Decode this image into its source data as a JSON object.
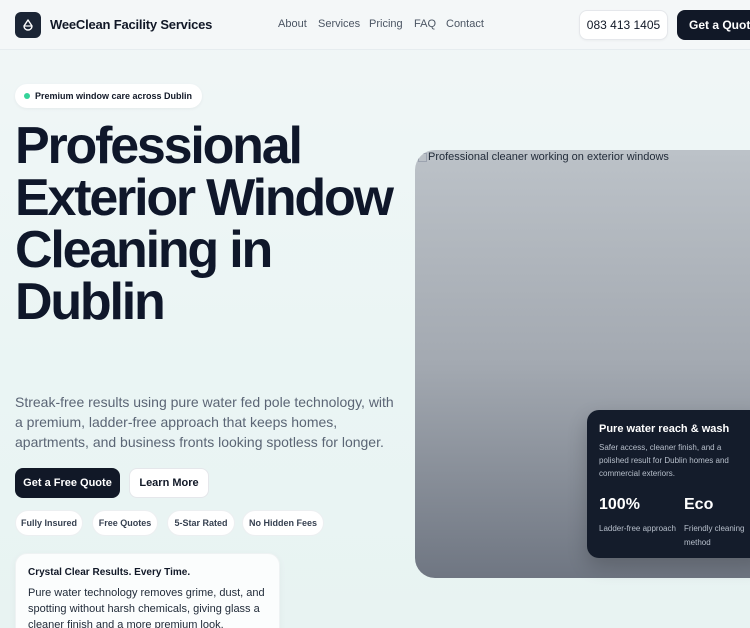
{
  "header": {
    "brand": "WeeClean Facility Services",
    "logo_icon": "drop-icon",
    "nav": [
      "About",
      "Services",
      "Pricing",
      "FAQ",
      "Contact"
    ],
    "phone": "083 413 1405",
    "quote_button": "Get a Quote"
  },
  "hero": {
    "pill": "Premium window care across Dublin",
    "title": "Professional Exterior Window Cleaning in Dublin",
    "subtitle": "Streak-free results using pure water fed pole technology, with a premium, ladder-free approach that keeps homes, apartments, and business fronts looking spotless for longer.",
    "primary_cta": "Get a Free Quote",
    "secondary_cta": "Learn More",
    "tags": [
      "Fully Insured",
      "Free Quotes",
      "5-Star Rated",
      "No Hidden Fees"
    ],
    "info_card": {
      "title": "Crystal Clear Results. Every Time.",
      "text": "Pure water technology removes grime, dust, and spotting without harsh chemicals, giving glass a cleaner finish and a more premium look."
    }
  },
  "image": {
    "alt": "Professional cleaner working on exterior windows"
  },
  "feature_card": {
    "title": "Pure water reach & wash",
    "text": "Safer access, cleaner finish, and a polished result for Dublin homes and commercial exteriors.",
    "stats": [
      {
        "value": "100%",
        "label": "Ladder-free approach"
      },
      {
        "value": "Eco",
        "label": "Friendly cleaning method"
      }
    ]
  },
  "colors": {
    "dark": "#111827",
    "accent_dot": "#34d399",
    "card_dark": "#141c2b"
  }
}
